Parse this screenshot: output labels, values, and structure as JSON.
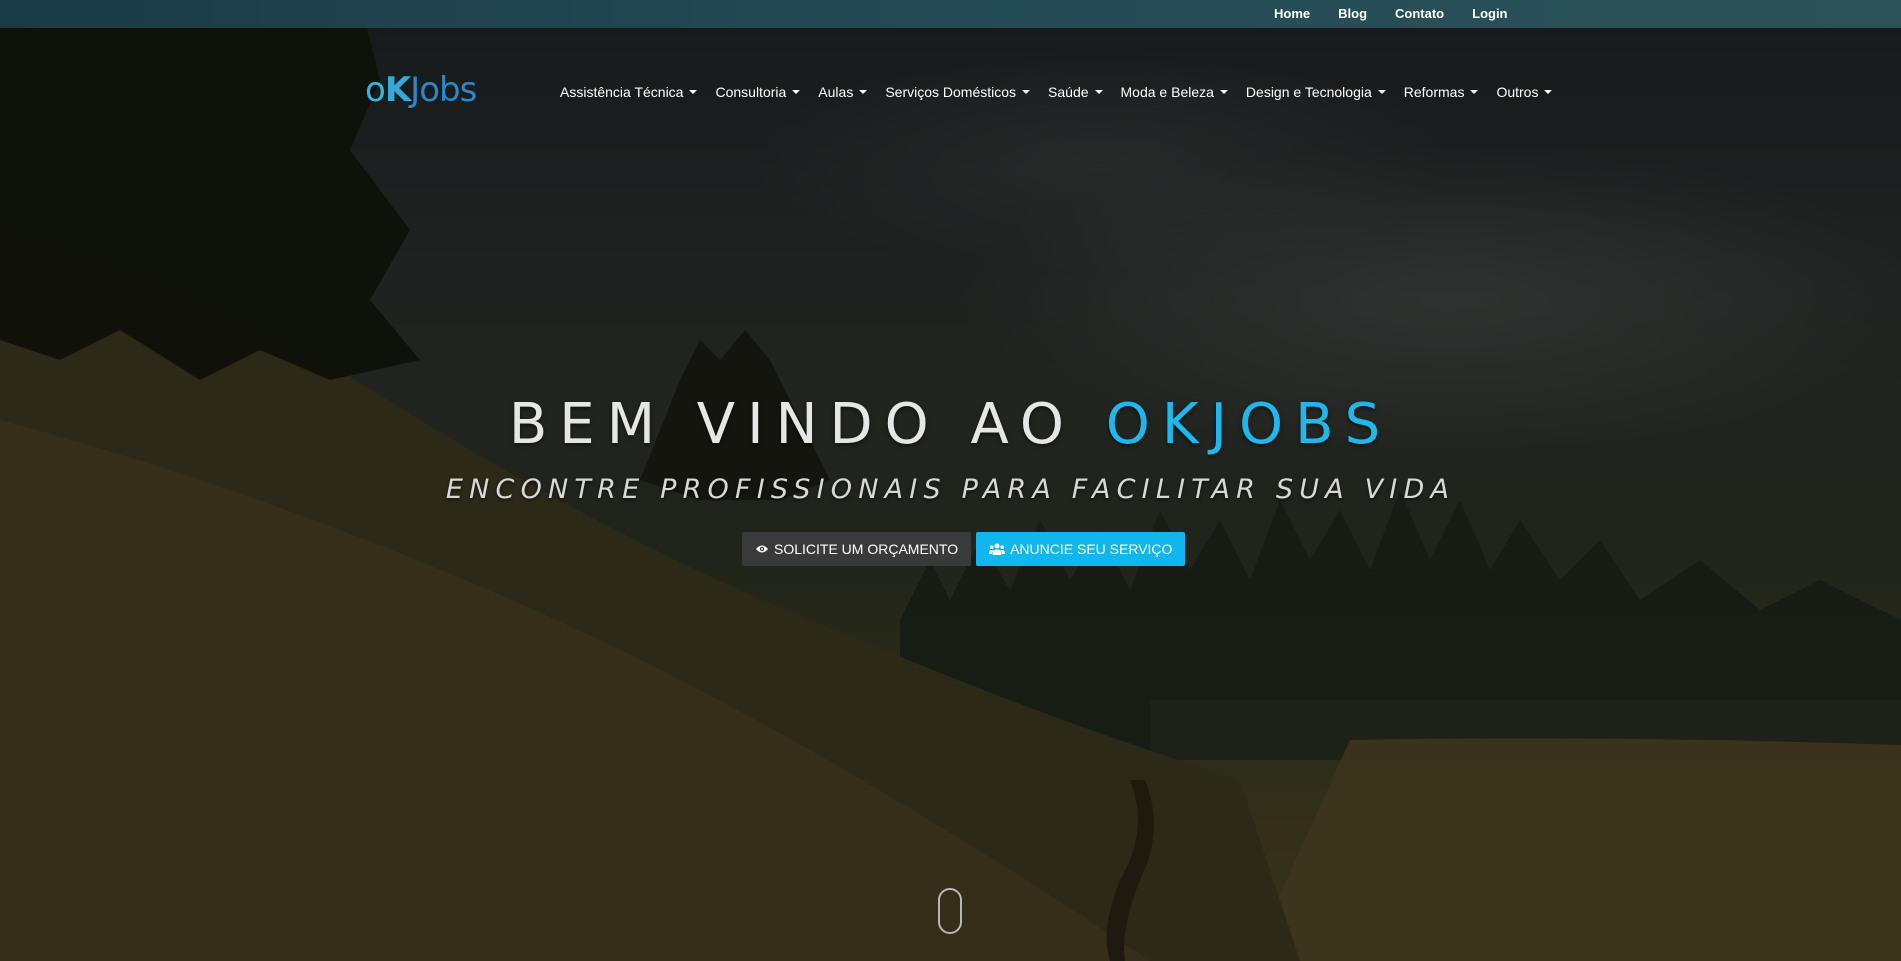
{
  "topbar": {
    "links": [
      "Home",
      "Blog",
      "Contato",
      "Login"
    ]
  },
  "logo": {
    "o": "o",
    "k": "K",
    "rest": "Jobs"
  },
  "nav": {
    "items": [
      "Assistência Técnica",
      "Consultoria",
      "Aulas",
      "Serviços Domésticos",
      "Saúde",
      "Moda e Beleza",
      "Design e Tecnologia",
      "Reformas",
      "Outros"
    ]
  },
  "hero": {
    "title_prefix": "BEM VINDO AO ",
    "title_accent": "OKJOBS",
    "subtitle": "ENCONTRE PROFISSIONAIS PARA FACILITAR SUA VIDA",
    "btn_quote": "SOLICITE UM ORÇAMENTO",
    "btn_service": "ANUNCIE SEU SERVIÇO"
  },
  "icons": {
    "quote_button": "eye-icon",
    "service_button": "users-icon",
    "scroll": "mouse-scroll-icon"
  },
  "colors": {
    "accent": "#1eb8ee",
    "button_dark": "#3a3a3a",
    "button_blue": "#12b6ef",
    "topbar": "#244b55"
  }
}
